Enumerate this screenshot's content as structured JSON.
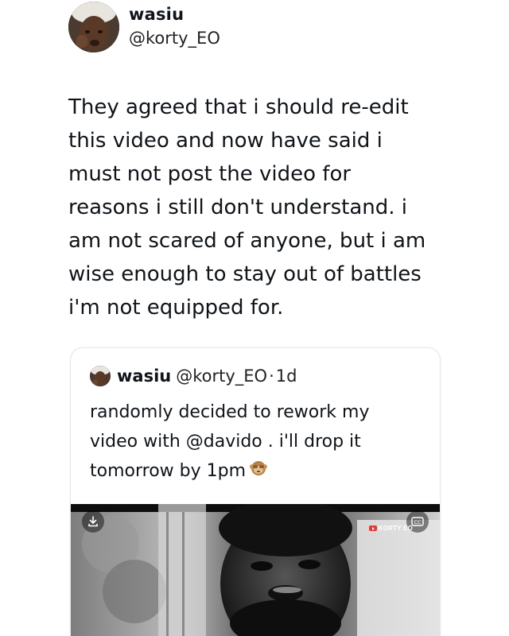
{
  "author": {
    "name": "wasiu",
    "handle": "@korty_EO"
  },
  "tweet": {
    "text": "They agreed that i should re-edit\nthis video and now have said i\nmust not post the video for\nreasons i still don't understand. i\nam not scared of anyone, but i am\nwise enough to stay out of battles\ni'm not equipped for."
  },
  "quoted_tweet": {
    "name": "wasiu",
    "handle": "@korty_EO",
    "separator": "·",
    "time": "1d",
    "text": "randomly decided to rework my\nvideo with @davido . i'll drop it\ntomorrow by 1pm",
    "emoji": "monkey-emoji"
  },
  "media": {
    "watermark": "KORTY EO",
    "download_icon": "download-icon",
    "cc_icon": "closed-captions-icon"
  }
}
